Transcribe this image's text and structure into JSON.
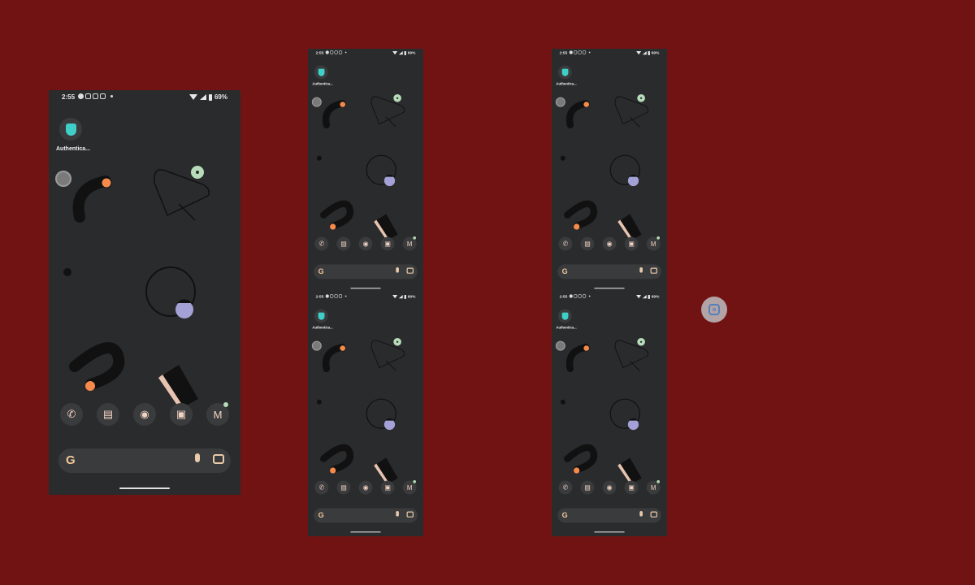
{
  "status": {
    "time": "2:55",
    "battery": "69%"
  },
  "app": {
    "label": "Authentica..."
  },
  "dock": [
    "phone-icon",
    "messages-icon",
    "chrome-icon",
    "camera-icon",
    "gmail-icon"
  ],
  "search": {
    "logo": "G"
  },
  "colors": {
    "background": "#721313",
    "phone_bg": "#2a2b2d",
    "accent_orange": "#f58a4b",
    "accent_purple": "#a4a1d6",
    "accent_mint": "#b7dcb9",
    "app_teal": "#3fcfc8"
  }
}
